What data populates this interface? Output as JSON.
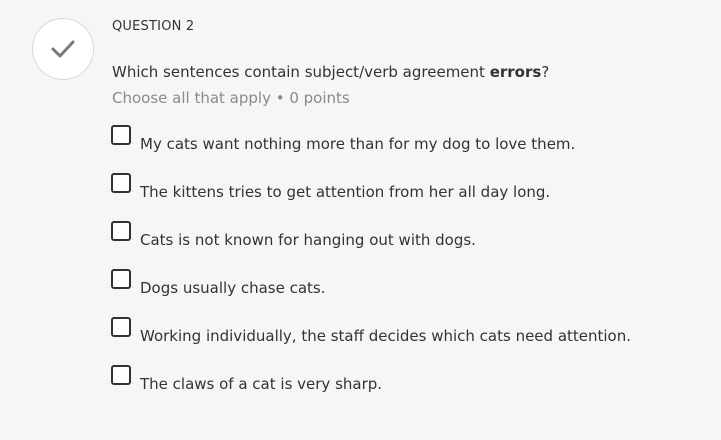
{
  "status_icon": "checkmark-icon",
  "question": {
    "label": "QUESTION 2",
    "prompt_before": "Which sentences contain subject/verb agreement ",
    "prompt_bold": "errors",
    "prompt_after": "?",
    "instructions": "Choose all that apply • 0 points"
  },
  "options": [
    {
      "text": "My cats want nothing more than for my dog to love them.",
      "checked": false
    },
    {
      "text": "The kittens tries to get attention from her all day long.",
      "checked": false
    },
    {
      "text": "Cats is not known for hanging out with dogs.",
      "checked": false
    },
    {
      "text": "Dogs usually chase cats.",
      "checked": false
    },
    {
      "text": "Working individually, the staff decides which cats need attention.",
      "checked": false
    },
    {
      "text": "The claws of a cat is very sharp.",
      "checked": false
    }
  ],
  "colors": {
    "background": "#f6f6f6",
    "text": "#333333",
    "muted": "#8a8a8a",
    "check_icon": "#7a7a7a"
  }
}
